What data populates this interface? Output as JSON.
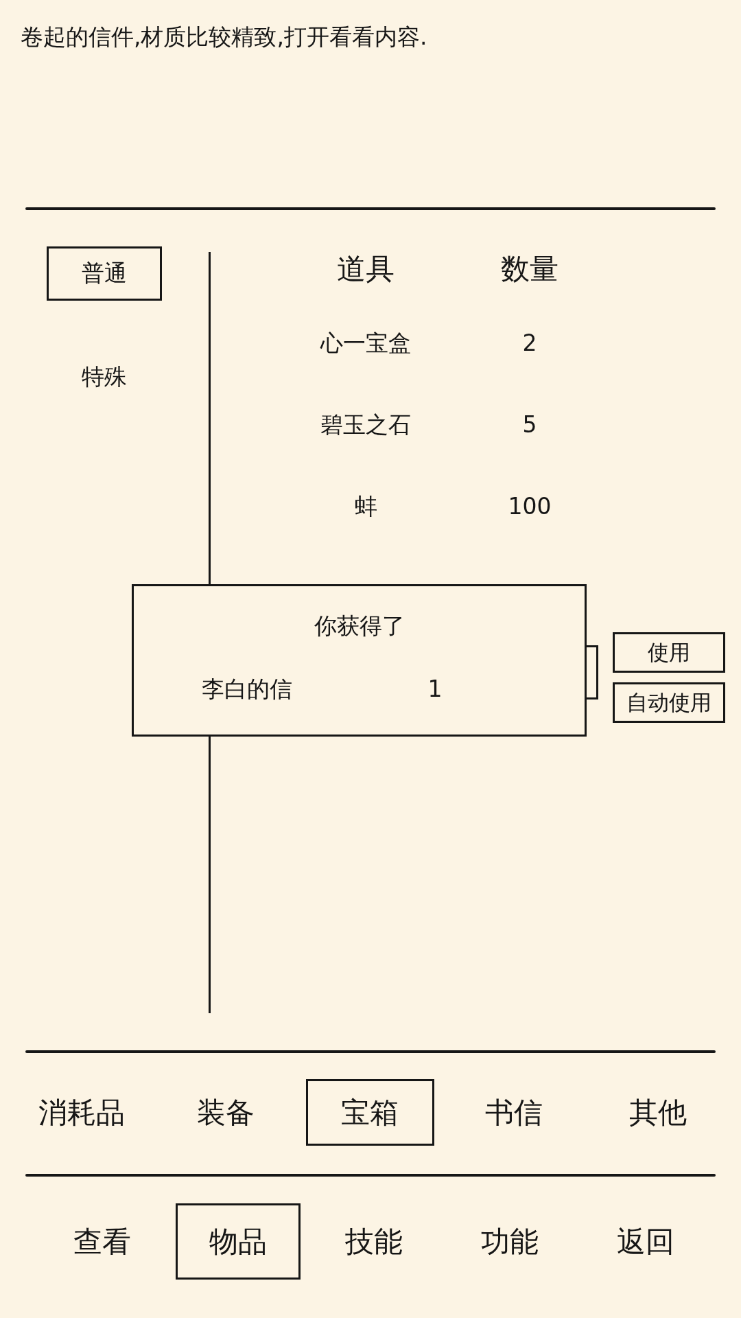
{
  "description": "卷起的信件,材质比较精致,打开看看内容.",
  "sidebar": {
    "items": [
      {
        "label": "普通",
        "selected": true
      },
      {
        "label": "特殊",
        "selected": false
      }
    ]
  },
  "table": {
    "columns": [
      "道具",
      "数量"
    ],
    "rows": [
      {
        "item": "心一宝盒",
        "count": "2"
      },
      {
        "item": "碧玉之石",
        "count": "5"
      },
      {
        "item": "蚌",
        "count": "100"
      }
    ]
  },
  "dialog": {
    "title": "你获得了",
    "items": [
      {
        "name": "李白的信",
        "count": "1"
      }
    ]
  },
  "actions": [
    "使用",
    "自动使用"
  ],
  "category_tabs": [
    {
      "label": "消耗品",
      "selected": false
    },
    {
      "label": "装备",
      "selected": false
    },
    {
      "label": "宝箱",
      "selected": true
    },
    {
      "label": "书信",
      "selected": false
    },
    {
      "label": "其他",
      "selected": false
    }
  ],
  "nav_tabs": [
    {
      "label": "查看",
      "selected": false
    },
    {
      "label": "物品",
      "selected": true
    },
    {
      "label": "技能",
      "selected": false
    },
    {
      "label": "功能",
      "selected": false
    },
    {
      "label": "返回",
      "selected": false
    }
  ]
}
